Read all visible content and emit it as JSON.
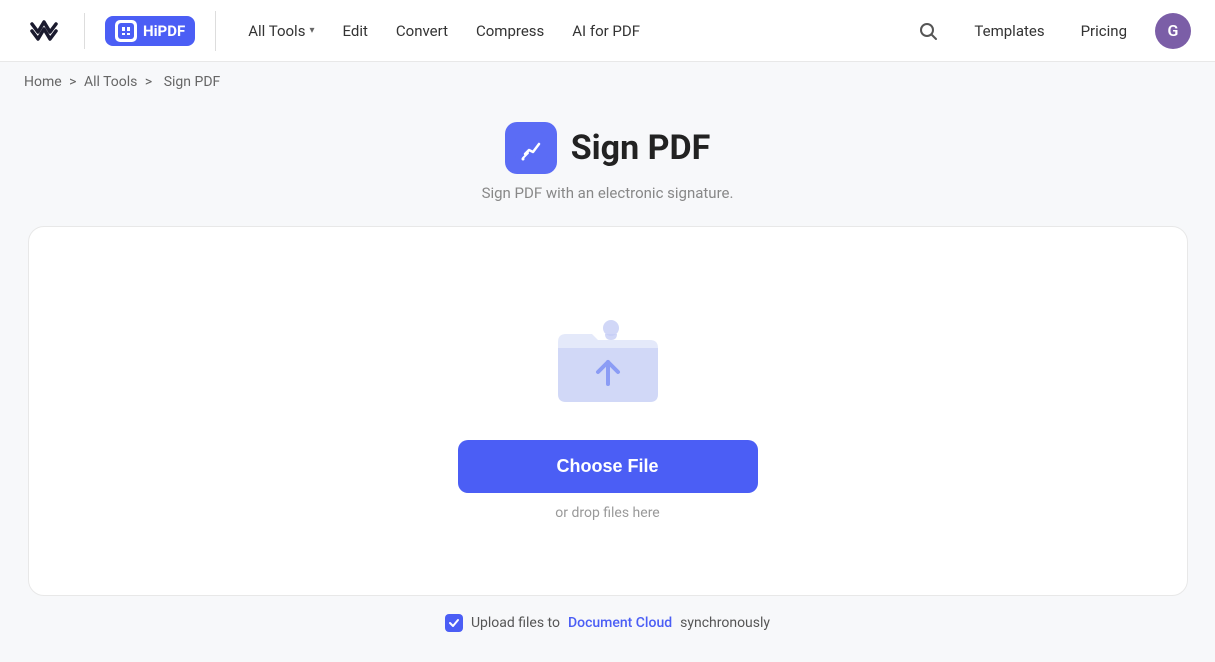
{
  "header": {
    "wondershare_label": "wondershare",
    "hipdf_label": "HiPDF",
    "nav": {
      "all_tools_label": "All Tools",
      "edit_label": "Edit",
      "convert_label": "Convert",
      "compress_label": "Compress",
      "ai_for_pdf_label": "AI for PDF"
    },
    "nav_right": {
      "templates_label": "Templates",
      "pricing_label": "Pricing"
    },
    "avatar_label": "G"
  },
  "breadcrumb": {
    "home": "Home",
    "all_tools": "All Tools",
    "current": "Sign PDF",
    "separator": ">"
  },
  "page": {
    "title": "Sign PDF",
    "subtitle": "Sign PDF with an electronic signature.",
    "choose_file_label": "Choose File",
    "drop_text": "or drop files here",
    "upload_checkbox_text_before": "Upload files to",
    "document_cloud_label": "Document Cloud",
    "upload_checkbox_text_after": "synchronously"
  }
}
